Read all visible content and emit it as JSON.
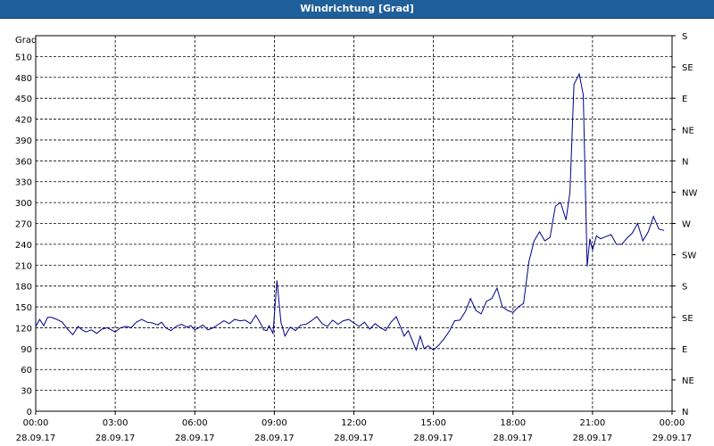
{
  "window": {
    "title": "Windrichtung [Grad]"
  },
  "chart_data": {
    "type": "line",
    "title": "Windrichtung [Grad]",
    "ylabel": "Grad",
    "ylim": [
      0,
      540
    ],
    "yticks": [
      0,
      30,
      60,
      90,
      120,
      150,
      180,
      210,
      240,
      270,
      300,
      330,
      360,
      390,
      420,
      450,
      480,
      510
    ],
    "right_axis_labels": [
      "N",
      "NE",
      "E",
      "SE",
      "S",
      "SW",
      "W",
      "NW",
      "N",
      "NE",
      "E",
      "SE",
      "S"
    ],
    "x_ticks": [
      {
        "time": "00:00",
        "date": "28.09.17"
      },
      {
        "time": "03:00",
        "date": "28.09.17"
      },
      {
        "time": "06:00",
        "date": "28.09.17"
      },
      {
        "time": "09:00",
        "date": "28.09.17"
      },
      {
        "time": "12:00",
        "date": "28.09.17"
      },
      {
        "time": "15:00",
        "date": "28.09.17"
      },
      {
        "time": "18:00",
        "date": "28.09.17"
      },
      {
        "time": "21:00",
        "date": "28.09.17"
      },
      {
        "time": "00:00",
        "date": "29.09.17"
      }
    ],
    "xlim_hours": [
      0,
      24
    ],
    "grid": true,
    "line_color": "#00008b",
    "series": [
      {
        "x_hours": [
          0,
          0.15,
          0.3,
          0.45,
          0.6,
          0.8,
          1.0,
          1.2,
          1.4,
          1.6,
          1.75,
          1.9,
          2.1,
          2.3,
          2.5,
          2.7,
          2.85,
          3.0,
          3.2,
          3.4,
          3.6,
          3.8,
          4.0,
          4.2,
          4.4,
          4.6,
          4.75,
          4.9,
          5.1,
          5.3,
          5.5,
          5.7,
          5.85,
          6.0,
          6.15,
          6.3,
          6.5,
          6.7,
          6.9,
          7.1,
          7.3,
          7.5,
          7.7,
          7.9,
          8.1,
          8.3,
          8.5,
          8.6,
          8.72,
          8.8,
          8.95,
          9.1,
          9.25,
          9.4,
          9.6,
          9.8,
          10.0,
          10.2,
          10.4,
          10.6,
          10.8,
          11.0,
          11.2,
          11.4,
          11.6,
          11.8,
          12.0,
          12.2,
          12.4,
          12.6,
          12.8,
          13.0,
          13.2,
          13.4,
          13.6,
          13.75,
          13.9,
          14.05,
          14.2,
          14.35,
          14.5,
          14.65,
          14.8,
          15.0,
          15.2,
          15.4,
          15.6,
          15.8,
          16.0,
          16.2,
          16.4,
          16.6,
          16.8,
          17.0,
          17.2,
          17.4,
          17.6,
          17.8,
          18.0,
          18.2,
          18.4,
          18.6,
          18.8,
          19.0,
          19.2,
          19.4,
          19.6,
          19.8,
          20.0,
          20.15,
          20.3,
          20.5,
          20.65,
          20.8,
          20.9,
          21.0,
          21.15,
          21.3,
          21.5,
          21.7,
          21.9,
          22.1,
          22.3,
          22.5,
          22.7,
          22.9,
          23.1,
          23.3,
          23.5,
          23.7,
          23.85,
          24.0
        ],
        "values": [
          122,
          132,
          123,
          135,
          135,
          132,
          128,
          118,
          110,
          122,
          117,
          114,
          117,
          112,
          118,
          120,
          117,
          114,
          120,
          122,
          120,
          128,
          132,
          128,
          127,
          124,
          128,
          120,
          116,
          122,
          125,
          121,
          123,
          117,
          120,
          124,
          117,
          120,
          125,
          130,
          126,
          132,
          130,
          131,
          126,
          138,
          125,
          117,
          116,
          123,
          112,
          188,
          128,
          108,
          121,
          116,
          124,
          125,
          130,
          136,
          126,
          122,
          131,
          125,
          130,
          132,
          127,
          122,
          128,
          118,
          126,
          120,
          116,
          128,
          136,
          122,
          108,
          116,
          102,
          88,
          108,
          90,
          94,
          88,
          95,
          104,
          115,
          130,
          131,
          143,
          162,
          145,
          140,
          158,
          162,
          177,
          150,
          145,
          142,
          150,
          155,
          215,
          245,
          258,
          245,
          250,
          295,
          300,
          275,
          315,
          470,
          485,
          455,
          208,
          248,
          232,
          252,
          248,
          251,
          254,
          240,
          240,
          249,
          256,
          270,
          245,
          258,
          280,
          262,
          260
        ]
      }
    ]
  }
}
